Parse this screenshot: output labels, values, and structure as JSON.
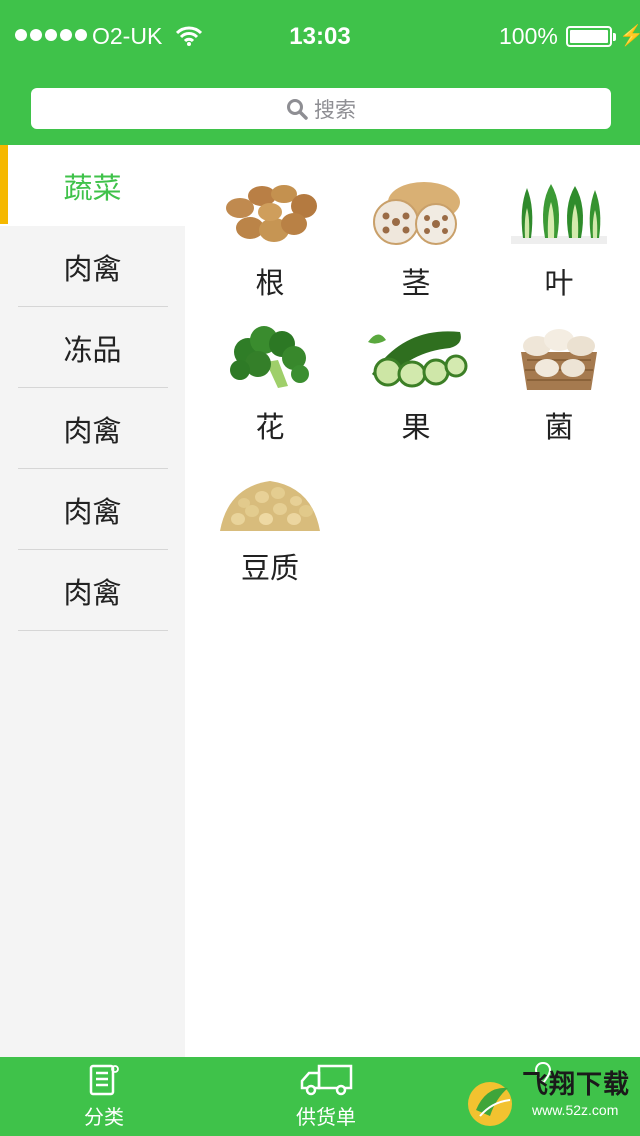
{
  "status_bar": {
    "carrier": "O2-UK",
    "time": "13:03",
    "battery_percent": "100%",
    "battery_level": 1.0
  },
  "search": {
    "placeholder": "搜索"
  },
  "sidebar": {
    "items": [
      {
        "label": "蔬菜",
        "active": true
      },
      {
        "label": "肉禽"
      },
      {
        "label": "冻品"
      },
      {
        "label": "肉禽"
      },
      {
        "label": "肉禽"
      },
      {
        "label": "肉禽"
      }
    ]
  },
  "categories": [
    {
      "label": "根",
      "image": "potato-image"
    },
    {
      "label": "茎",
      "image": "lotus-root-image"
    },
    {
      "label": "叶",
      "image": "bok-choy-image"
    },
    {
      "label": "花",
      "image": "broccoli-image"
    },
    {
      "label": "果",
      "image": "cucumber-image"
    },
    {
      "label": "菌",
      "image": "mushroom-image"
    },
    {
      "label": "豆质",
      "image": "soybean-image"
    }
  ],
  "tabbar": {
    "tabs": [
      {
        "label": "分类",
        "icon": "list-icon"
      },
      {
        "label": "供货单",
        "icon": "truck-icon"
      }
    ]
  },
  "watermark": {
    "text": "飞翔下载",
    "url": "www.52z.com"
  },
  "colors": {
    "brand_green": "#3fc24a",
    "active_indicator": "#f5b800",
    "sidebar_bg": "#f4f4f4"
  }
}
